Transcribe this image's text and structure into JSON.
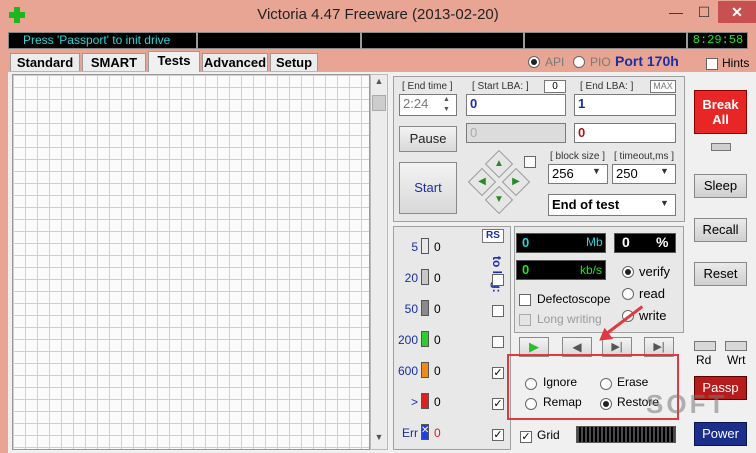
{
  "window": {
    "title": "Victoria 4.47  Freeware (2013-02-20)",
    "min_glyph": "—",
    "max_glyph": "☐",
    "close_glyph": "✕"
  },
  "status": {
    "message": "Press 'Passport' to init drive",
    "clock": "8:29:58"
  },
  "tabs": [
    {
      "label": "Standard"
    },
    {
      "label": "SMART"
    },
    {
      "label": "Tests"
    },
    {
      "label": "Advanced"
    },
    {
      "label": "Setup"
    }
  ],
  "port": {
    "api_label": "API",
    "pio_label": "PIO",
    "port_label": "Port 170h",
    "hints_label": "Hints"
  },
  "test_params": {
    "end_time_label": "[ End time ]",
    "end_time_value": "2:24",
    "start_lba_label": "[ Start LBA: ]",
    "start_lba_zero": "0",
    "start_lba_value": "0",
    "start_lba_secondary": "0",
    "end_lba_label": "[ End LBA: ]",
    "end_lba_max": "MAX",
    "end_lba_value": "1",
    "end_lba_secondary": "0",
    "pause_label": "Pause",
    "start_label": "Start",
    "block_size_label": "[ block size ]",
    "block_size_value": "256",
    "timeout_label": "[ timeout,ms ]",
    "timeout_value": "250",
    "end_action_value": "End of test"
  },
  "counters": {
    "rs_label": "RS",
    "to_log_label": "to log:",
    "rows": [
      {
        "label": "5",
        "value": "0",
        "color": "#e8e8e8"
      },
      {
        "label": "20",
        "value": "0",
        "color": "#c8c8c8"
      },
      {
        "label": "50",
        "value": "0",
        "color": "#8a8a8a"
      },
      {
        "label": "200",
        "value": "0",
        "color": "#2ecc2e"
      },
      {
        "label": "600",
        "value": "0",
        "color": "#f08a1c"
      },
      {
        "label": ">",
        "value": "0",
        "color": "#e02020"
      },
      {
        "label": "Err",
        "value": "0",
        "color": "#2040e0"
      }
    ],
    "err_mark": "✕"
  },
  "speed": {
    "position_value": "0",
    "position_unit": "Mb",
    "percent_value": "0",
    "percent_unit": "%",
    "speed_value": "0",
    "speed_unit": "kb/s"
  },
  "mode": {
    "verify_label": "verify",
    "read_label": "read",
    "write_label": "write",
    "defectoscope_label": "Defectoscope",
    "long_writing_label": "Long writing"
  },
  "actions": {
    "ignore_label": "Ignore",
    "erase_label": "Erase",
    "remap_label": "Remap",
    "restore_label": "Restore",
    "grid_label": "Grid"
  },
  "side": {
    "break_all_label": "Break All",
    "sleep_label": "Sleep",
    "recall_label": "Recall",
    "reset_label": "Reset",
    "rd_label": "Rd",
    "wrt_label": "Wrt",
    "passp_label": "Passp",
    "power_label": "Power"
  },
  "watermark": "SOFT"
}
